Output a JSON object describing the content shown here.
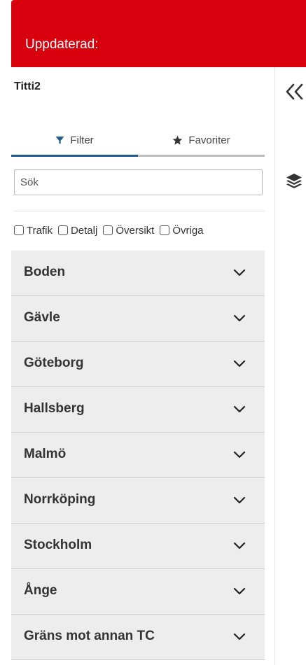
{
  "banner": {
    "text": "Uppdaterad:"
  },
  "panel": {
    "title": "Titti2",
    "tabs": [
      {
        "label": "Filter",
        "icon": "filter-icon",
        "active": true
      },
      {
        "label": "Favoriter",
        "icon": "star-icon",
        "active": false
      }
    ],
    "search": {
      "placeholder": "Sök",
      "value": ""
    },
    "checkboxes": [
      {
        "label": "Trafik",
        "checked": false
      },
      {
        "label": "Detalj",
        "checked": false
      },
      {
        "label": "Översikt",
        "checked": false
      },
      {
        "label": "Övriga",
        "checked": false
      }
    ],
    "groups": [
      {
        "label": "Boden"
      },
      {
        "label": "Gävle"
      },
      {
        "label": "Göteborg"
      },
      {
        "label": "Hallsberg"
      },
      {
        "label": "Malmö"
      },
      {
        "label": "Norrköping"
      },
      {
        "label": "Stockholm"
      },
      {
        "label": "Ånge"
      },
      {
        "label": "Gräns mot annan TC"
      }
    ]
  },
  "sidebar": {
    "icons": [
      "double-chevron-left-icon",
      "layers-icon"
    ]
  },
  "colors": {
    "banner": "#d9000d",
    "active_tab": "#1e5a8c",
    "group_bg": "#ededed"
  }
}
